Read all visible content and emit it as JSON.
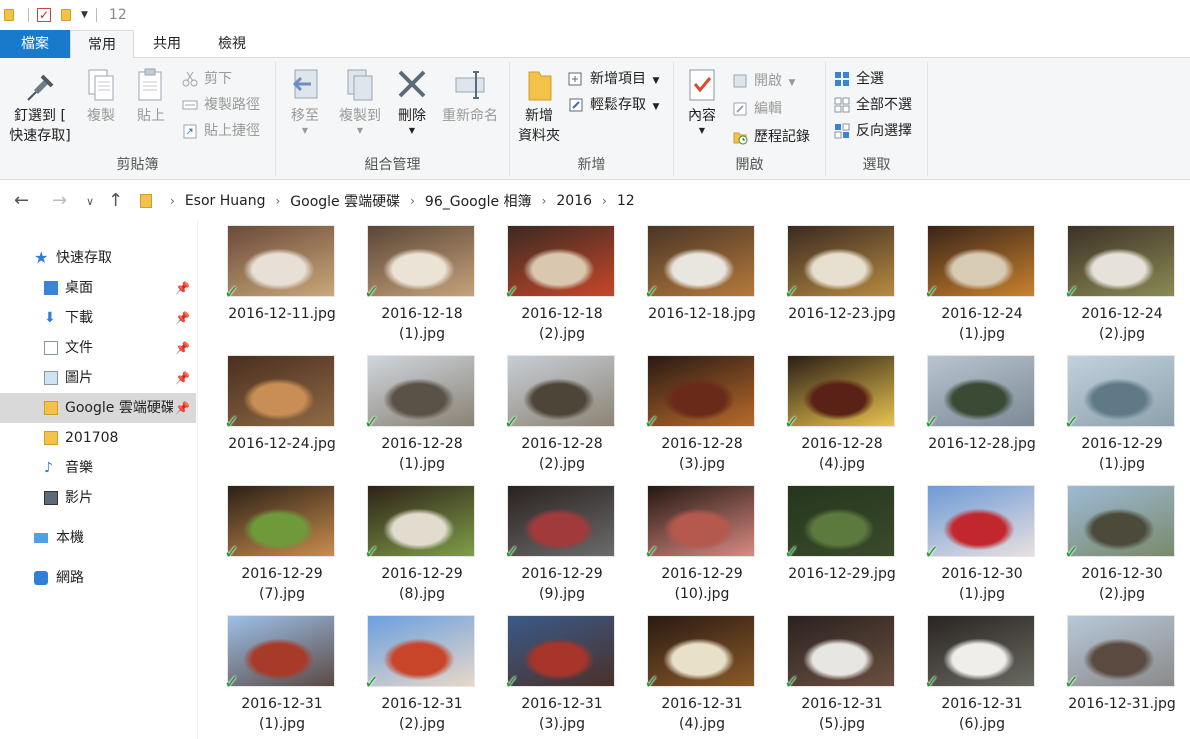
{
  "titlebar": {
    "title": "12"
  },
  "tabs": [
    {
      "label": "檔案"
    },
    {
      "label": "常用"
    },
    {
      "label": "共用"
    },
    {
      "label": "檢視"
    }
  ],
  "ribbon": {
    "clipboard": {
      "label": "剪貼簿",
      "pin": "釘選到 [\n快速存取]",
      "copy": "複製",
      "paste": "貼上",
      "cut": "剪下",
      "copy_path": "複製路徑",
      "paste_shortcut": "貼上捷徑"
    },
    "organize": {
      "label": "組合管理",
      "move_to": "移至",
      "copy_to": "複製到",
      "delete": "刪除",
      "rename": "重新命名"
    },
    "new": {
      "label": "新增",
      "new_folder": "新增\n資料夾",
      "new_item": "新增項目",
      "easy_access": "輕鬆存取"
    },
    "open": {
      "label": "開啟",
      "properties": "內容",
      "open": "開啟",
      "edit": "編輯",
      "history": "歷程記錄"
    },
    "select": {
      "label": "選取",
      "select_all": "全選",
      "select_none": "全部不選",
      "invert": "反向選擇"
    }
  },
  "address": {
    "crumbs": [
      "Esor Huang",
      "Google 雲端硬碟",
      "96_Google 相簿",
      "2016",
      "12"
    ]
  },
  "sidebar": {
    "quick_access": "快速存取",
    "items": [
      {
        "label": "桌面",
        "icon": "desktop-icon"
      },
      {
        "label": "下載",
        "icon": "download-icon"
      },
      {
        "label": "文件",
        "icon": "document-icon"
      },
      {
        "label": "圖片",
        "icon": "picture-icon"
      },
      {
        "label": "Google 雲端硬碟",
        "icon": "google-drive-icon"
      },
      {
        "label": "201708",
        "icon": "folder-icon"
      },
      {
        "label": "音樂",
        "icon": "music-icon"
      },
      {
        "label": "影片",
        "icon": "video-icon"
      }
    ],
    "this_pc": "本機",
    "network": "網路"
  },
  "files": [
    {
      "name": "2016-12-11.jpg",
      "colors": [
        "#6b4a3a",
        "#e8e0d6",
        "#c9a87a"
      ]
    },
    {
      "name": "2016-12-18\n(1).jpg",
      "colors": [
        "#5a4636",
        "#ebe3d5",
        "#c6a27b"
      ]
    },
    {
      "name": "2016-12-18\n(2).jpg",
      "colors": [
        "#3b2a22",
        "#d9c7b0",
        "#c6472a"
      ]
    },
    {
      "name": "2016-12-18.jpg",
      "colors": [
        "#4a3526",
        "#e9e5df",
        "#b57a3c"
      ]
    },
    {
      "name": "2016-12-23.jpg",
      "colors": [
        "#3a2a20",
        "#e7dfcf",
        "#b78a42"
      ]
    },
    {
      "name": "2016-12-24\n(1).jpg",
      "colors": [
        "#3a2418",
        "#d8cbb4",
        "#c8822e"
      ]
    },
    {
      "name": "2016-12-24\n(2).jpg",
      "colors": [
        "#3d3126",
        "#e6e2da",
        "#8a8a55"
      ]
    },
    {
      "name": "2016-12-24.jpg",
      "colors": [
        "#4a2e1e",
        "#c98e55",
        "#8f6a45"
      ]
    },
    {
      "name": "2016-12-28\n(1).jpg",
      "colors": [
        "#cfd6de",
        "#5a5246",
        "#8a8274"
      ]
    },
    {
      "name": "2016-12-28\n(2).jpg",
      "colors": [
        "#c7ced7",
        "#4d4538",
        "#8d8474"
      ]
    },
    {
      "name": "2016-12-28\n(3).jpg",
      "colors": [
        "#2a1a14",
        "#6a2a1a",
        "#b86a2a"
      ]
    },
    {
      "name": "2016-12-28\n(4).jpg",
      "colors": [
        "#2b1e16",
        "#5a2216",
        "#e8c44e"
      ]
    },
    {
      "name": "2016-12-28.jpg",
      "colors": [
        "#b9c4cf",
        "#3b4a35",
        "#7b8a96"
      ]
    },
    {
      "name": "2016-12-29\n(1).jpg",
      "colors": [
        "#c2d1de",
        "#5f7a86",
        "#8da1ad"
      ]
    },
    {
      "name": "2016-12-29\n(7).jpg",
      "colors": [
        "#2c2016",
        "#6e9a3a",
        "#c98d4e"
      ]
    },
    {
      "name": "2016-12-29\n(8).jpg",
      "colors": [
        "#2e2218",
        "#e2dccf",
        "#7e9e48"
      ]
    },
    {
      "name": "2016-12-29\n(9).jpg",
      "colors": [
        "#2a2220",
        "#a13a3a",
        "#6b6b6b"
      ]
    },
    {
      "name": "2016-12-29\n(10).jpg",
      "colors": [
        "#241812",
        "#b5584e",
        "#d98a82"
      ]
    },
    {
      "name": "2016-12-29.jpg",
      "colors": [
        "#26361e",
        "#5d7a3e",
        "#3a4a2a"
      ]
    },
    {
      "name": "2016-12-30\n(1).jpg",
      "colors": [
        "#6d9ad6",
        "#c1272d",
        "#e8e0e0"
      ]
    },
    {
      "name": "2016-12-30\n(2).jpg",
      "colors": [
        "#9dbad6",
        "#4c4a3a",
        "#7a8a6a"
      ]
    },
    {
      "name": "2016-12-31\n(1).jpg",
      "colors": [
        "#9ec0e8",
        "#a83a2a",
        "#5a4a44"
      ]
    },
    {
      "name": "2016-12-31\n(2).jpg",
      "colors": [
        "#6aa0e0",
        "#c8452a",
        "#e8d8c8"
      ]
    },
    {
      "name": "2016-12-31\n(3).jpg",
      "colors": [
        "#3a5a8a",
        "#a8352a",
        "#4a3028"
      ]
    },
    {
      "name": "2016-12-31\n(4).jpg",
      "colors": [
        "#2a1a12",
        "#e8e0c8",
        "#8a5a2a"
      ]
    },
    {
      "name": "2016-12-31\n(5).jpg",
      "colors": [
        "#2a2220",
        "#e8e6e2",
        "#6a5040"
      ]
    },
    {
      "name": "2016-12-31\n(6).jpg",
      "colors": [
        "#2a2422",
        "#f0eeea",
        "#6a6a60"
      ]
    },
    {
      "name": "2016-12-31.jpg",
      "colors": [
        "#b8c8d8",
        "#5a4a40",
        "#8a8a8a"
      ]
    }
  ]
}
